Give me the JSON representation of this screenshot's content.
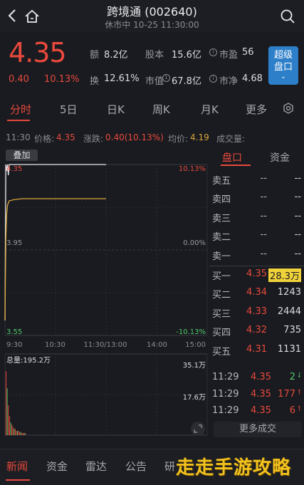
{
  "header": {
    "title": "跨境通 (002640)",
    "subtitle": "休市中 10-25 11:30:00"
  },
  "quote": {
    "price": "4.35",
    "change": "0.40",
    "change_pct": "10.13%",
    "amount_label": "额",
    "amount": "8.2亿",
    "turnover_label": "换",
    "turnover": "12.61%",
    "float_shares_label": "股本",
    "float_shares": "15.6亿",
    "market_value_label": "市值",
    "market_value_badge": "1",
    "market_value": "67.8亿",
    "pe_label": "市盈",
    "pe_badge": "i",
    "pe": "56",
    "pb_label": "市净",
    "pb_badge": "i",
    "pb": "4.68",
    "super_button": [
      "超级",
      "盘口"
    ]
  },
  "periods": [
    "分时",
    "5日",
    "日K",
    "周K",
    "月K",
    "更多"
  ],
  "infobar": {
    "time": "11:30",
    "price_label": "价格:",
    "price": "4.35",
    "change_label": "涨跌:",
    "change": "0.40(10.13%)",
    "avg_label": "均价:",
    "avg": "4.19",
    "volume_label": "成交量:"
  },
  "chart": {
    "overlay_label": "叠加",
    "price_top": "4.35",
    "price_mid": "3.95",
    "price_bottom": "3.55",
    "pct_top": "10.13%",
    "pct_mid": "0.00%",
    "pct_bottom": "-10.13%",
    "time_labels": [
      "9:30",
      "10:30",
      "11:30/13:00",
      "14:00",
      "15:00"
    ],
    "volume_label": "总量:195.2万",
    "volume_top": "35.1万",
    "volume_mid": "17.6万"
  },
  "chart_data": {
    "type": "line",
    "x": [
      "09:30",
      "09:31",
      "09:32",
      "09:33",
      "09:34",
      "09:35",
      "09:40",
      "09:50",
      "10:00",
      "10:30",
      "11:00",
      "11:30"
    ],
    "series": [
      {
        "values": [
          3.62,
          4.35,
          4.32,
          4.35,
          4.3,
          4.35,
          4.35,
          4.35,
          4.35,
          4.35,
          4.35,
          4.35
        ]
      },
      {
        "values": [
          3.62,
          4.0,
          4.12,
          4.16,
          4.17,
          4.18,
          4.185,
          4.19,
          4.19,
          4.19,
          4.19,
          4.19
        ]
      }
    ],
    "ylim": [
      3.55,
      4.35
    ],
    "volume_ylim": [
      0,
      35.1
    ]
  },
  "order_tabs": [
    "盘口",
    "资金"
  ],
  "orderbook": {
    "asks": [
      {
        "label": "卖五",
        "price": "--",
        "volume": "--"
      },
      {
        "label": "卖四",
        "price": "--",
        "volume": "--"
      },
      {
        "label": "卖三",
        "price": "--",
        "volume": "--"
      },
      {
        "label": "卖二",
        "price": "--",
        "volume": "--"
      },
      {
        "label": "卖一",
        "price": "--",
        "volume": "--"
      }
    ],
    "bids": [
      {
        "label": "买一",
        "price": "4.35",
        "volume": "28.3万"
      },
      {
        "label": "买二",
        "price": "4.34",
        "volume": "1243"
      },
      {
        "label": "买三",
        "price": "4.33",
        "volume": "2444"
      },
      {
        "label": "买四",
        "price": "4.32",
        "volume": "735"
      },
      {
        "label": "买五",
        "price": "4.31",
        "volume": "1131"
      }
    ]
  },
  "trades": [
    {
      "time": "11:29",
      "price": "4.35",
      "volume": "2",
      "arrow": "⇃",
      "color": "#4fc86a"
    },
    {
      "time": "11:29",
      "price": "4.35",
      "volume": "177",
      "arrow": "↿",
      "color": "#e8493c"
    },
    {
      "time": "11:29",
      "price": "4.35",
      "volume": "6",
      "arrow": "↿",
      "color": "#e8493c"
    }
  ],
  "more_trades": "更多成交",
  "news_tabs": [
    "新闻",
    "资金",
    "雷达",
    "公告",
    "研"
  ],
  "watermark": "走走手游攻略",
  "colors": {
    "up": "#e8493c",
    "down": "#4fc86a",
    "avg": "#d9a63a",
    "accent": "#2d7fc9"
  }
}
